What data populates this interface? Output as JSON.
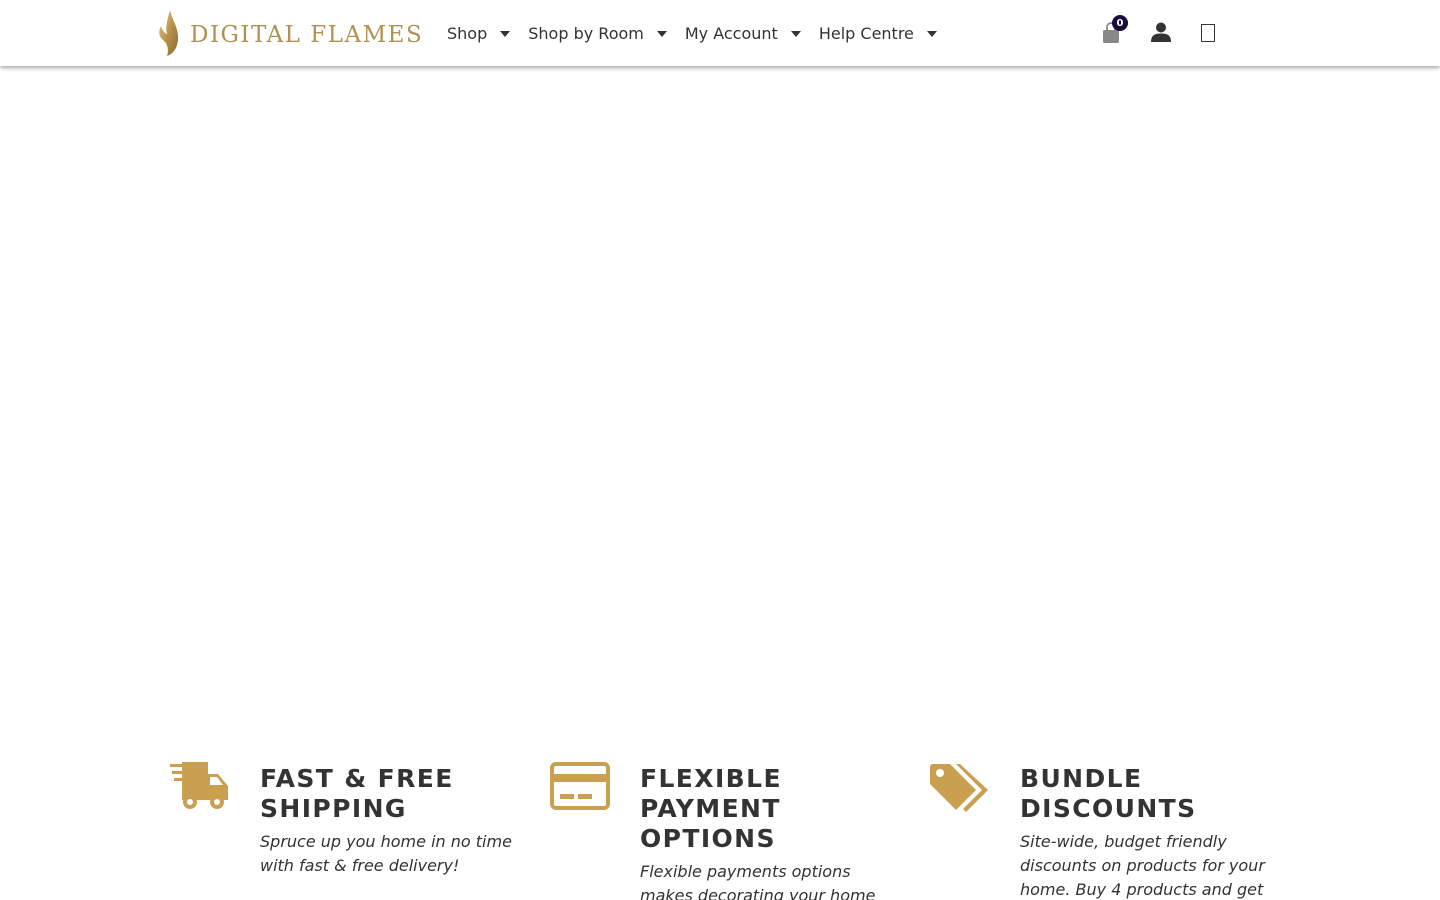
{
  "brand": {
    "name": "DIGITAL FLAMES",
    "accent_color": "#b29052"
  },
  "nav": {
    "items": [
      {
        "label": "Shop"
      },
      {
        "label": "Shop by Room"
      },
      {
        "label": "My Account"
      },
      {
        "label": "Help Centre"
      }
    ]
  },
  "header_icons": {
    "cart_icon": "shopping-bag-icon",
    "cart_count": "0",
    "account_icon": "user-icon",
    "search_icon": "missing-glyph-icon"
  },
  "features": [
    {
      "icon": "fast-truck-icon",
      "title": "FAST & FREE SHIPPING",
      "text": "Spruce up you home in no time with fast & free delivery!"
    },
    {
      "icon": "credit-card-icon",
      "title": "FLEXIBLE PAYMENT OPTIONS",
      "text": "Flexible payments options makes decorating your home"
    },
    {
      "icon": "tags-icon",
      "title": "BUNDLE DISCOUNTS",
      "text": "Site-wide, budget friendly discounts on products for your home. Buy 4 products and get"
    }
  ]
}
